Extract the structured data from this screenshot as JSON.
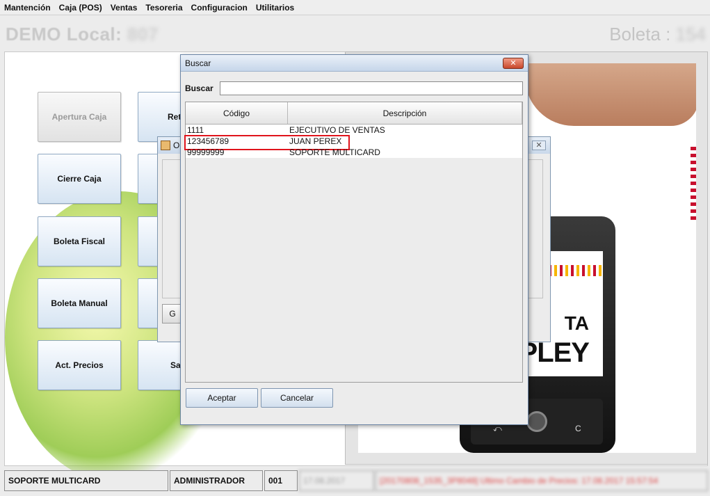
{
  "menu": [
    "Mantención",
    "Caja (POS)",
    "Ventas",
    "Tesoreria",
    "Configuracion",
    "Utilitarios"
  ],
  "header": {
    "local_label": "DEMO Local:",
    "local_number": "807",
    "boleta_label": "Boleta :",
    "boleta_number": "154"
  },
  "tiles": {
    "apertura": "Apertura Caja",
    "cierre": "Cierre Caja",
    "boleta_fiscal": "Boleta Fiscal",
    "boleta_manual": "Boleta Manual",
    "act_precios": "Act. Precios",
    "col2_row1": "Ret",
    "col2_row5": "Sa"
  },
  "mid_dialog": {
    "title_fragment": "O",
    "close_glyph": "✕",
    "button_fragment": "G"
  },
  "buscar": {
    "title": "Buscar",
    "close_glyph": "✕",
    "search_label": "Buscar",
    "search_value": "",
    "columns": [
      "Código",
      "Descripción"
    ],
    "rows": [
      {
        "codigo": "1111",
        "descripcion": "EJECUTIVO DE VENTAS"
      },
      {
        "codigo": "123456789",
        "descripcion": "JUAN PEREX"
      },
      {
        "codigo": "99999999",
        "descripcion": "SOPORTE MULTICARD"
      }
    ],
    "accept_label": "Aceptar",
    "cancel_label": "Cancelar"
  },
  "ad": {
    "line1": "TA",
    "line2": "PLEY",
    "key_back": "⤺",
    "key_c": "C"
  },
  "status": {
    "user": "SOPORTE MULTICARD",
    "role": "ADMINISTRADOR",
    "caja": "001",
    "date": "17.08.2017",
    "message": "[20170808_1535_3P8048] Ultimo Cambio de Precios: 17.08.2017 15:57:54"
  }
}
